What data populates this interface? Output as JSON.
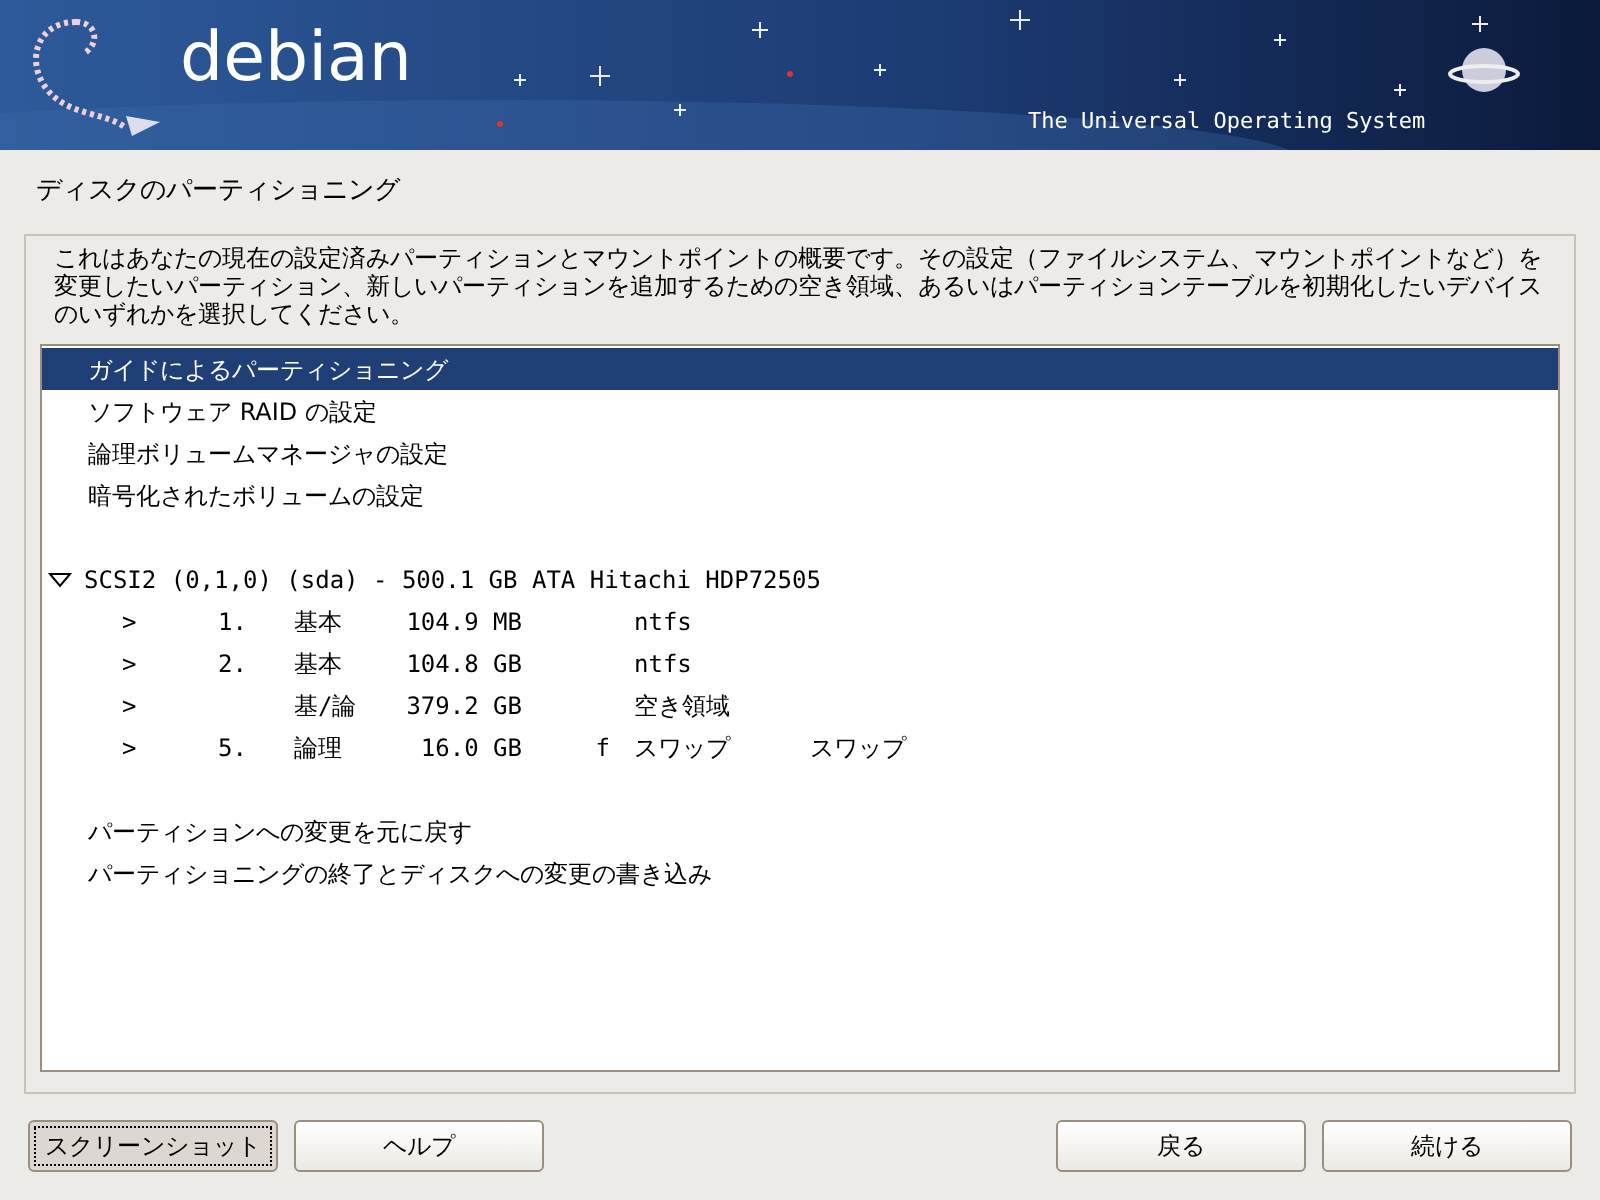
{
  "banner": {
    "logo": "debian",
    "tagline": "The Universal Operating System"
  },
  "title": "ディスクのパーティショニング",
  "description": "これはあなたの現在の設定済みパーティションとマウントポイントの概要です。その設定（ファイルシステム、マウントポイントなど）を変更したいパーティション、新しいパーティションを追加するための空き領域、あるいはパーティションテーブルを初期化したいデバイスのいずれかを選択してください。",
  "list": [
    {
      "kind": "action",
      "label": "ガイドによるパーティショニング",
      "selected": true
    },
    {
      "kind": "action",
      "label": "ソフトウェア RAID の設定",
      "selected": false
    },
    {
      "kind": "action",
      "label": "論理ボリュームマネージャの設定",
      "selected": false
    },
    {
      "kind": "action",
      "label": "暗号化されたボリュームの設定",
      "selected": false
    },
    {
      "kind": "blank"
    },
    {
      "kind": "disk",
      "label": "SCSI2 (0,1,0) (sda) - 500.1 GB ATA Hitachi HDP72505",
      "expanded": true,
      "selected": false,
      "children": [
        {
          "kind": "partition",
          "arrow": ">",
          "number": "1.",
          "type": "基本",
          "size": "104.9 MB",
          "filesystem": "ntfs",
          "selected": false
        },
        {
          "kind": "partition",
          "arrow": ">",
          "number": "2.",
          "type": "基本",
          "size": "104.8 GB",
          "filesystem": "ntfs",
          "selected": false
        },
        {
          "kind": "partition",
          "arrow": ">",
          "type": "基/論",
          "size": "379.2 GB",
          "filesystem": "空き領域",
          "selected": false
        },
        {
          "kind": "partition",
          "arrow": ">",
          "number": "5.",
          "type": "論理",
          "size": "16.0 GB",
          "flag": "f",
          "filesystem": "スワップ",
          "mount": "スワップ",
          "selected": false
        }
      ]
    },
    {
      "kind": "blank"
    },
    {
      "kind": "action",
      "label": "パーティションへの変更を元に戻す",
      "selected": false
    },
    {
      "kind": "action",
      "label": "パーティショニングの終了とディスクへの変更の書き込み",
      "selected": false
    }
  ],
  "buttons": [
    {
      "label": "スクリーンショット",
      "focused": true
    },
    {
      "label": "ヘルプ",
      "focused": false
    }
  ],
  "nav_buttons": [
    {
      "label": "戻る",
      "focused": false
    },
    {
      "label": "続ける",
      "focused": false
    }
  ]
}
